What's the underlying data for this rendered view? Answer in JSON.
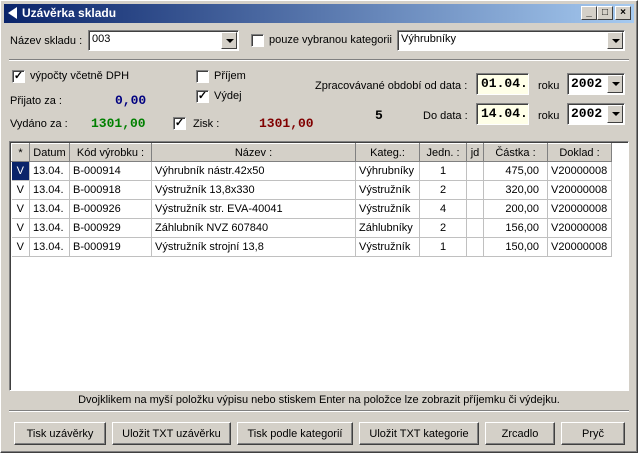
{
  "window": {
    "title": "Uzávěrka skladu",
    "min_label": "_",
    "max_label": "□",
    "close_label": "×"
  },
  "filters": {
    "warehouse_label": "Název skladu :",
    "warehouse_value": "003",
    "only_category_checked": false,
    "only_category_label": "pouze vybranou kategorii",
    "category_value": "Výhrubníky"
  },
  "summary": {
    "vat_checked": true,
    "vat_label": "výpočty včetně DPH",
    "received_label": "Přijato za :",
    "received_value": "0,00",
    "issued_label": "Vydáno za :",
    "issued_value": "1301,00",
    "receipt_checked": false,
    "receipt_label": "Příjem",
    "issue_checked": true,
    "issue_label": "Výdej",
    "profit_checked": true,
    "profit_label": "Zisk :",
    "profit_value": "1301,00",
    "count_value": "5",
    "colors": {
      "received": "#000080",
      "issued": "#008000",
      "profit": "#800000"
    }
  },
  "period": {
    "from_label": "Zpracovávané období od data :",
    "from_value": "01.04.",
    "to_label": "Do data :",
    "to_value": "14.04.",
    "year_label": "roku",
    "year_from": "2002",
    "year_to": "2002"
  },
  "table": {
    "headers": [
      "*",
      "Datum",
      "Kód výrobku :",
      "Název :",
      "Kateg.:",
      "Jedn. :",
      "jd",
      "Částka :",
      "Doklad :"
    ],
    "rows": [
      [
        "V",
        "13.04.",
        "B-000914",
        "Výhrubník nástr.42x50",
        "Výhrubníky",
        "1",
        "",
        "475,00",
        "V20000008"
      ],
      [
        "V",
        "13.04.",
        "B-000918",
        "Výstružník 13,8x330",
        "Výstružník",
        "2",
        "",
        "320,00",
        "V20000008"
      ],
      [
        "V",
        "13.04.",
        "B-000926",
        "Výstružník str. EVA-40041",
        "Výstružník",
        "4",
        "",
        "200,00",
        "V20000008"
      ],
      [
        "V",
        "13.04.",
        "B-000929",
        "Záhlubník NVZ 607840",
        "Záhlubníky",
        "2",
        "",
        "156,00",
        "V20000008"
      ],
      [
        "V",
        "13.04.",
        "B-000919",
        "Výstružník strojní 13,8",
        "Výstružník",
        "1",
        "",
        "150,00",
        "V20000008"
      ]
    ]
  },
  "hint": "Dvojklikem na myší položku výpisu nebo stiskem Enter na položce lze zobrazit příjemku či výdejku.",
  "buttons": {
    "print_closing": "Tisk uzávěrky",
    "save_txt_closing": "Uložit TXT uzávěrku",
    "print_by_category": "Tisk podle kategorií",
    "save_txt_category": "Uložit TXT kategorie",
    "mirror": "Zrcadlo",
    "exit": "Pryč"
  }
}
